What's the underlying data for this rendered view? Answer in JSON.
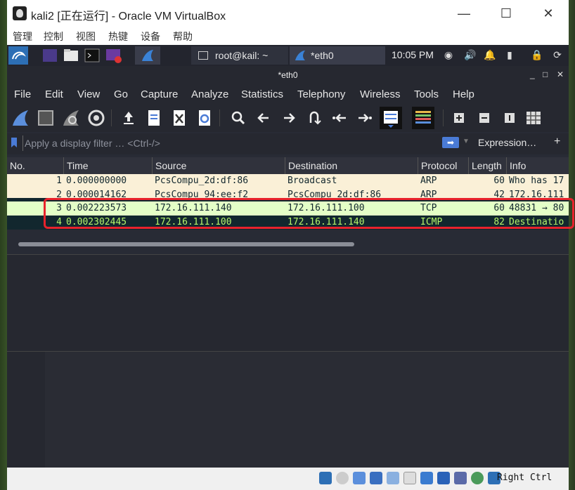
{
  "window": {
    "title": "kali2 [正在运行] - Oracle VM VirtualBox",
    "minimize": "—",
    "maximize": "☐",
    "close": "✕"
  },
  "host_menu": [
    "管理",
    "控制",
    "视图",
    "热键",
    "设备",
    "帮助"
  ],
  "kali_bar": {
    "task_terminal": "root@kail: ~",
    "task_wireshark": "*eth0",
    "clock": "10:05 PM"
  },
  "wireshark": {
    "title": "*eth0",
    "controls": [
      "_",
      "□",
      "✕"
    ],
    "menu": [
      "File",
      "Edit",
      "View",
      "Go",
      "Capture",
      "Analyze",
      "Statistics",
      "Telephony",
      "Wireless",
      "Tools",
      "Help"
    ],
    "filter_placeholder": "Apply a display filter … <Ctrl-/>",
    "expression_label": "Expression…",
    "plus": "+"
  },
  "packet_list": {
    "columns": [
      "No.",
      "Time",
      "Source",
      "Destination",
      "Protocol",
      "Length",
      "Info"
    ],
    "rows": [
      {
        "no": "1",
        "time": "0.000000000",
        "src": "PcsCompu_2d:df:86",
        "dst": "Broadcast",
        "proto": "ARP",
        "len": "60",
        "info": "Who has 17"
      },
      {
        "no": "2",
        "time": "0.000014162",
        "src": "PcsCompu_94:ee:f2",
        "dst": "PcsCompu_2d:df:86",
        "proto": "ARP",
        "len": "42",
        "info": "172.16.111"
      },
      {
        "no": "3",
        "time": "0.002223573",
        "src": "172.16.111.140",
        "dst": "172.16.111.100",
        "proto": "TCP",
        "len": "60",
        "info": "48831 → 80"
      },
      {
        "no": "4",
        "time": "0.002302445",
        "src": "172.16.111.100",
        "dst": "172.16.111.140",
        "proto": "ICMP",
        "len": "82",
        "info": "Destinatio"
      }
    ]
  },
  "status": {
    "host_key": "Right Ctrl"
  },
  "colors": {
    "arp_bg": "#faf0d7",
    "tcp_bg": "#e4ffc7",
    "icmp_bg": "#12272e",
    "icmp_fg": "#b5f56a",
    "highlight_border": "#e8222c"
  }
}
